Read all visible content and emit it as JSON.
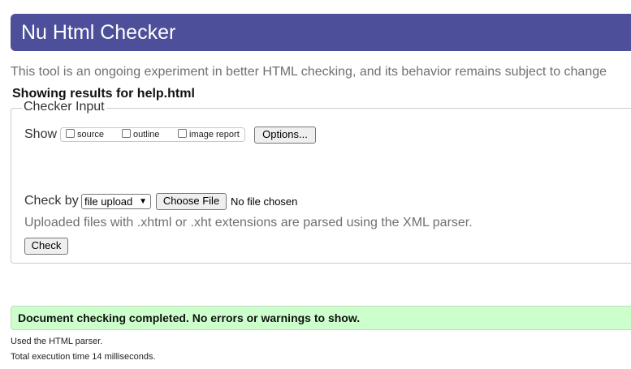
{
  "header": {
    "title": "Nu Html Checker"
  },
  "intro": "This tool is an ongoing experiment in better HTML checking, and its behavior remains subject to change",
  "results_for": "Showing results for help.html",
  "checker_input": {
    "legend": "Checker Input",
    "show_label": "Show",
    "show_options": [
      {
        "label": "source",
        "checked": false
      },
      {
        "label": "outline",
        "checked": false
      },
      {
        "label": "image report",
        "checked": false
      }
    ],
    "options_button": "Options...",
    "check_by_label": "Check by",
    "check_by_selected": "file upload",
    "choose_file_button": "Choose File",
    "no_file_text": "No file chosen",
    "parser_note": "Uploaded files with .xhtml or .xht extensions are parsed using the XML parser.",
    "check_button": "Check"
  },
  "result": {
    "message": "Document checking completed. No errors or warnings to show.",
    "color": "#ccffcc"
  },
  "footer": {
    "parser_used": "Used the HTML parser.",
    "execution_time": "Total execution time 14 milliseconds."
  },
  "colors": {
    "header_bg": "#4d4f9a",
    "success_bg": "#ccffcc"
  }
}
